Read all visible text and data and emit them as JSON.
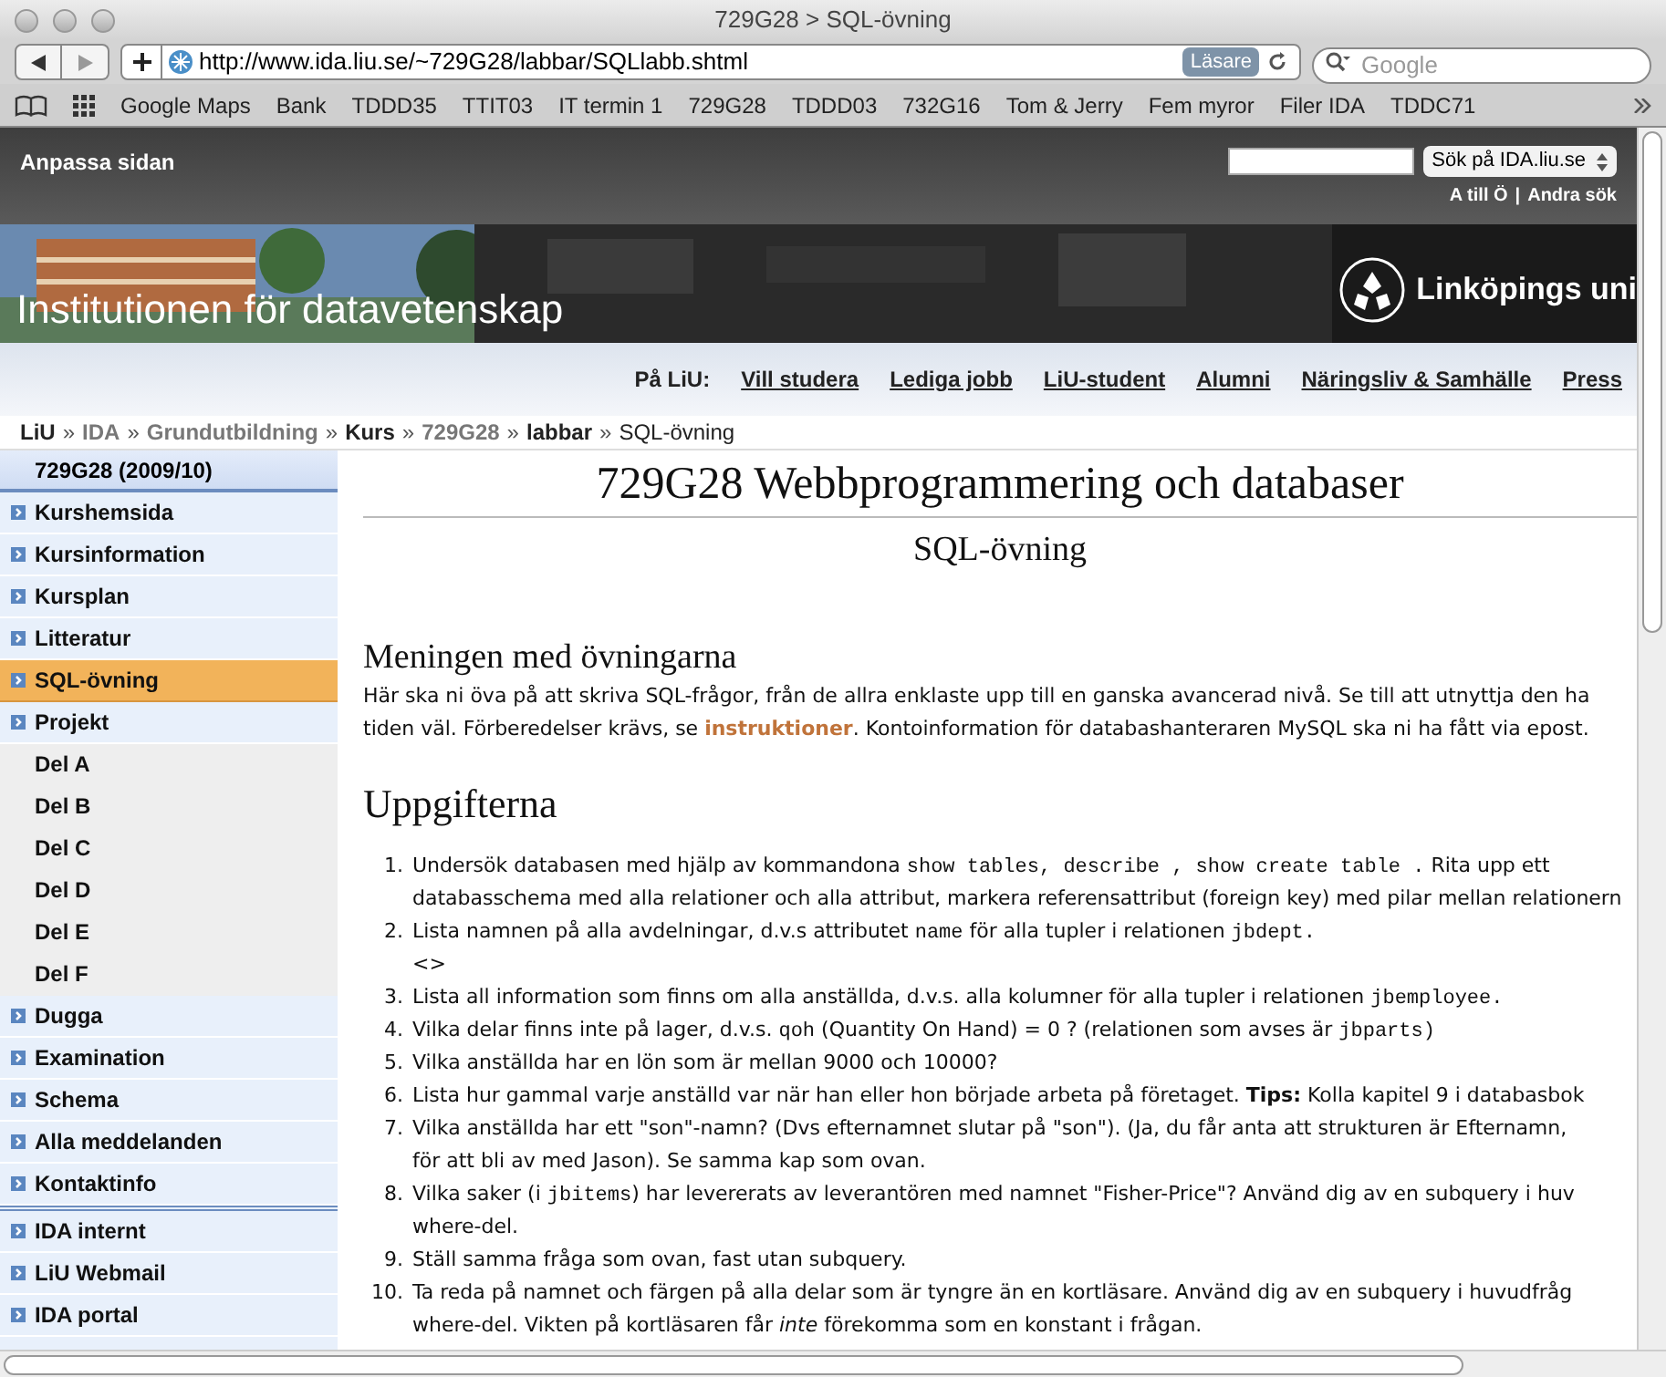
{
  "window": {
    "title": "729G28 > SQL-övning"
  },
  "toolbar": {
    "url": "http://www.ida.liu.se/~729G28/labbar/SQLlabb.shtml",
    "reader": "Läsare",
    "search": {
      "placeholder": "Google"
    }
  },
  "bookmarks": [
    "Google Maps",
    "Bank",
    "TDDD35",
    "TTIT03",
    "IT termin 1",
    "729G28",
    "TDDD03",
    "732G16",
    "Tom & Jerry",
    "Fem myror",
    "Filer IDA",
    "TDDC71"
  ],
  "site_header": {
    "customize": "Anpassa sidan",
    "search_scope": "Sök på IDA.liu.se",
    "links": [
      "A till Ö",
      "|",
      "Andra sök"
    ]
  },
  "banner": {
    "title": "Institutionen för datavetenskap",
    "logo_text": "Linköpings uni"
  },
  "nav": {
    "label": "På LiU:",
    "links": [
      "Vill studera",
      "Lediga jobb",
      "LiU-student",
      "Alumni",
      "Näringsliv & Samhälle",
      "Press"
    ]
  },
  "breadcrumb": [
    {
      "label": "LiU",
      "kind": "link",
      "visited": false
    },
    {
      "separator": "»",
      "label": "IDA",
      "kind": "link",
      "visited": true
    },
    {
      "separator": "»",
      "label": "Grundutbildning",
      "kind": "link",
      "visited": true
    },
    {
      "separator": "»",
      "label": "Kurs",
      "kind": "link",
      "visited": false
    },
    {
      "separator": "»",
      "label": "729G28",
      "kind": "link",
      "visited": true
    },
    {
      "separator": "»",
      "label": "labbar",
      "kind": "link",
      "visited": false
    },
    {
      "separator": "»",
      "label": "SQL-övning",
      "kind": "current",
      "visited": false
    }
  ],
  "sidebar": {
    "title": "729G28 (2009/10)",
    "groups": [
      [
        {
          "label": "Kurshemsida",
          "kind": "main",
          "selected": false
        },
        {
          "label": "Kursinformation",
          "kind": "main",
          "selected": false
        },
        {
          "label": "Kursplan",
          "kind": "main",
          "selected": false
        },
        {
          "label": "Litteratur",
          "kind": "main",
          "selected": false
        },
        {
          "label": "SQL-övning",
          "kind": "main",
          "selected": true
        },
        {
          "label": "Projekt",
          "kind": "main",
          "selected": false
        },
        {
          "label": "Del A",
          "kind": "sub",
          "selected": false
        },
        {
          "label": "Del B",
          "kind": "sub",
          "selected": false
        },
        {
          "label": "Del C",
          "kind": "sub",
          "selected": false
        },
        {
          "label": "Del D",
          "kind": "sub",
          "selected": false
        },
        {
          "label": "Del E",
          "kind": "sub",
          "selected": false
        },
        {
          "label": "Del F",
          "kind": "sub",
          "selected": false
        },
        {
          "label": "Dugga",
          "kind": "main",
          "selected": false
        },
        {
          "label": "Examination",
          "kind": "main",
          "selected": false
        },
        {
          "label": "Schema",
          "kind": "main",
          "selected": false
        },
        {
          "label": "Alla meddelanden",
          "kind": "main",
          "selected": false
        },
        {
          "label": "Kontaktinfo",
          "kind": "main",
          "selected": false
        }
      ],
      [
        {
          "label": "IDA internt",
          "kind": "main",
          "selected": false
        },
        {
          "label": "LiU Webmail",
          "kind": "main",
          "selected": false
        },
        {
          "label": "IDA portal",
          "kind": "main",
          "selected": false
        }
      ]
    ]
  },
  "content": {
    "title": "729G28 Webbprogrammering och databaser",
    "subtitle": "SQL-övning",
    "intro": {
      "heading": "Meningen med övningarna",
      "lines": [
        [
          {
            "kind": "text",
            "text": "Här ska ni öva på att skriva SQL-frågor, från de allra enklaste upp till en ganska avancerad nivå. Se till att utnyttja den ha"
          }
        ],
        [
          {
            "kind": "text",
            "text": "tiden väl. Förberedelser krävs, se "
          },
          {
            "kind": "link",
            "text": "instruktioner"
          },
          {
            "kind": "text",
            "text": ". Kontoinformation för databashanteraren MySQL ska ni ha fått via epost."
          }
        ]
      ]
    },
    "tasks": {
      "heading": "Uppgifterna",
      "items": [
        {
          "number": "1.",
          "lines": [
            [
              {
                "kind": "text",
                "text": "Undersök databasen med hjälp av kommandona "
              },
              {
                "kind": "code",
                "text": "show tables, describe , show create table ."
              },
              {
                "kind": "text",
                "text": " Rita upp ett"
              }
            ],
            [
              {
                "kind": "text",
                "text": "databasschema med alla relationer och alla attribut, markera referensattribut (foreign key) med pilar mellan relationern"
              }
            ]
          ]
        },
        {
          "number": "2.",
          "lines": [
            [
              {
                "kind": "text",
                "text": "Lista namnen på alla avdelningar, d.v.s attributet "
              },
              {
                "kind": "code",
                "text": "name"
              },
              {
                "kind": "text",
                "text": " för alla tupler i relationen "
              },
              {
                "kind": "code",
                "text": "jbdept."
              }
            ],
            [
              {
                "kind": "text",
                "text": "<>"
              }
            ]
          ]
        },
        {
          "number": "3.",
          "lines": [
            [
              {
                "kind": "text",
                "text": "Lista all information som finns om alla anställda, d.v.s. alla kolumner för alla tupler i relationen "
              },
              {
                "kind": "code",
                "text": "jbemployee."
              }
            ]
          ]
        },
        {
          "number": "4.",
          "lines": [
            [
              {
                "kind": "text",
                "text": "Vilka delar finns inte på lager, d.v.s. "
              },
              {
                "kind": "code",
                "text": "qoh"
              },
              {
                "kind": "text",
                "text": " (Quantity On Hand) = 0 ?  (relationen som avses är "
              },
              {
                "kind": "code",
                "text": "jbparts)"
              }
            ]
          ]
        },
        {
          "number": "5.",
          "lines": [
            [
              {
                "kind": "text",
                "text": "Vilka anställda har en lön som är mellan 9000 och 10000?"
              }
            ]
          ]
        },
        {
          "number": "6.",
          "lines": [
            [
              {
                "kind": "text",
                "text": "Lista hur gammal varje anställd var när han eller hon började arbeta på företaget. "
              },
              {
                "kind": "bold",
                "text": "Tips:"
              },
              {
                "kind": "text",
                "text": " Kolla kapitel 9 i databasbok"
              }
            ]
          ]
        },
        {
          "number": "7.",
          "lines": [
            [
              {
                "kind": "text",
                "text": "Vilka anställda har ett \"son\"-namn? (Dvs efternamnet slutar på \"son\"). (Ja, du får anta att strukturen är Efternamn,"
              }
            ],
            [
              {
                "kind": "text",
                "text": "för att bli av med Jason). Se samma kap som ovan."
              }
            ]
          ]
        },
        {
          "number": "8.",
          "lines": [
            [
              {
                "kind": "text",
                "text": "Vilka saker (i "
              },
              {
                "kind": "code",
                "text": "jbitems"
              },
              {
                "kind": "text",
                "text": ") har levererats av leverantören med namnet \"Fisher-Price\"? Använd dig av en subquery i huv"
              }
            ],
            [
              {
                "kind": "text",
                "text": "where-del."
              }
            ]
          ]
        },
        {
          "number": "9.",
          "lines": [
            [
              {
                "kind": "text",
                "text": "Ställ samma fråga som ovan, fast utan subquery."
              }
            ]
          ]
        },
        {
          "number": "10.",
          "lines": [
            [
              {
                "kind": "text",
                "text": "Ta reda på namnet och färgen på alla delar som är tyngre än en kortläsare. Använd dig av en subquery i huvudfråg"
              }
            ],
            [
              {
                "kind": "text",
                "text": "where-del. Vikten på kortläsaren får "
              },
              {
                "kind": "italic",
                "text": "inte"
              },
              {
                "kind": "text",
                "text": " förekomma som en konstant i frågan."
              }
            ]
          ]
        }
      ]
    }
  }
}
